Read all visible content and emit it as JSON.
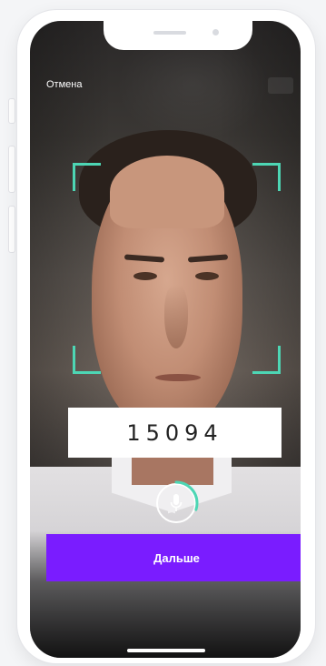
{
  "top_bar": {
    "cancel_label": "Отмена"
  },
  "verification": {
    "code": "15094",
    "frame_color": "#4dd6b4",
    "mic_icon": "microphone-icon",
    "recording_progress": 0.3
  },
  "actions": {
    "next_label": "Дальше",
    "next_color": "#7a1cff"
  }
}
